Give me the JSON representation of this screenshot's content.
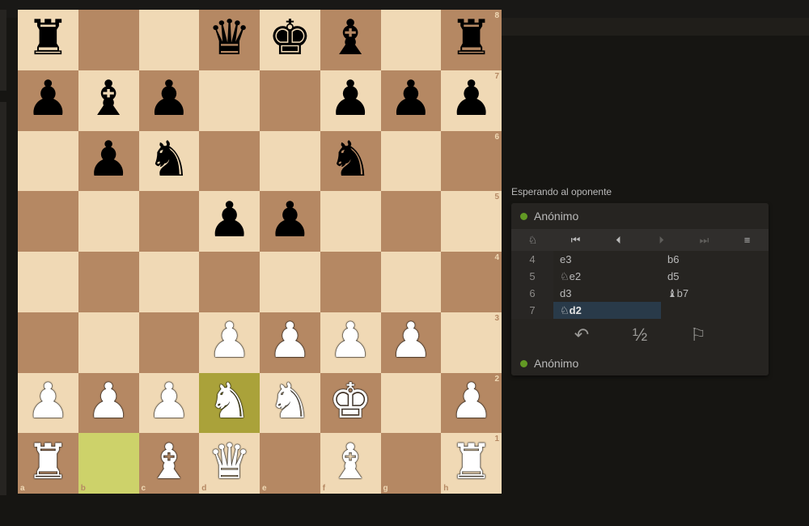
{
  "board": {
    "ranks": [
      "8",
      "7",
      "6",
      "5",
      "4",
      "3",
      "2",
      "1"
    ],
    "files": [
      "a",
      "b",
      "c",
      "d",
      "e",
      "f",
      "g",
      "h"
    ],
    "rows": [
      [
        "r",
        "",
        "",
        "q",
        "k",
        "b",
        "",
        "r"
      ],
      [
        "p",
        "b",
        "p",
        "",
        "",
        "p",
        "p",
        "p"
      ],
      [
        "",
        "p",
        "n",
        "",
        "",
        "n",
        "",
        ""
      ],
      [
        "",
        "",
        "",
        "p",
        "p",
        "",
        "",
        ""
      ],
      [
        "",
        "",
        "",
        "",
        "",
        "",
        "",
        ""
      ],
      [
        "",
        "",
        "",
        "P",
        "P",
        "P",
        "P",
        ""
      ],
      [
        "P",
        "P",
        "P",
        "N",
        "N",
        "K",
        "",
        "P"
      ],
      [
        "R",
        "",
        "B",
        "Q",
        "",
        "B",
        "",
        "R"
      ]
    ],
    "highlights": [
      "d2",
      "b1"
    ],
    "colors": {
      "light": "#f0d9b5",
      "dark": "#b58863",
      "hl_dark": "#aaa23a",
      "hl_light": "#cdd26a"
    }
  },
  "status": "Esperando al oponente",
  "player_top": {
    "name": "Anónimo",
    "online_color": "#629924"
  },
  "player_bottom": {
    "name": "Anónimo",
    "online_color": "#629924"
  },
  "controls": [
    {
      "name": "analysis-icon",
      "glyph": "♘",
      "disabled": false
    },
    {
      "name": "first-move-icon",
      "glyph": "⏮",
      "disabled": false
    },
    {
      "name": "prev-move-icon",
      "glyph": "⏴",
      "disabled": false
    },
    {
      "name": "next-move-icon",
      "glyph": "⏵",
      "disabled": true
    },
    {
      "name": "last-move-icon",
      "glyph": "⏭",
      "disabled": true
    },
    {
      "name": "menu-icon",
      "glyph": "≡",
      "disabled": false
    }
  ],
  "moves": [
    {
      "num": "4",
      "white": "e3",
      "black": "b6"
    },
    {
      "num": "5",
      "white": "♘e2",
      "black": "d5"
    },
    {
      "num": "6",
      "white": "d3",
      "black": "♝b7"
    },
    {
      "num": "7",
      "white": "♘d2",
      "black": "",
      "active": "white"
    }
  ],
  "actions": [
    {
      "name": "takeback-icon",
      "glyph": "↶"
    },
    {
      "name": "draw-offer-icon",
      "glyph": "½"
    },
    {
      "name": "resign-flag-icon",
      "glyph": "⚐"
    }
  ]
}
